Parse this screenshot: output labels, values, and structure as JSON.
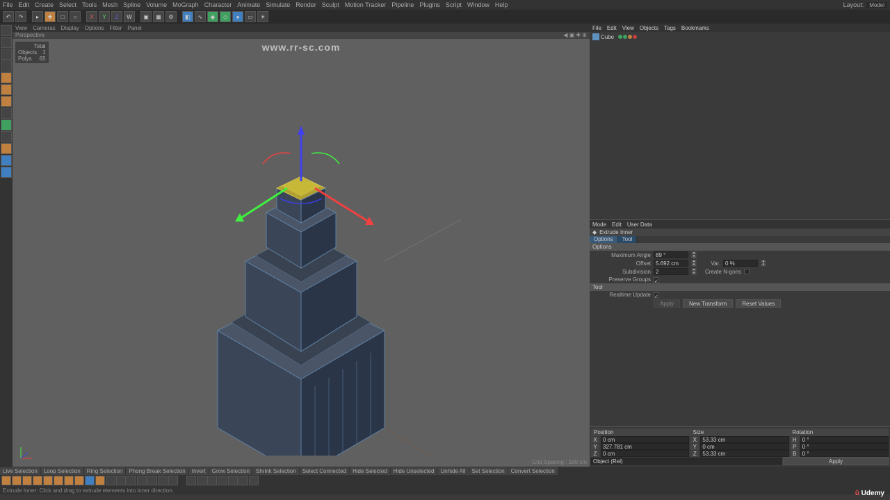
{
  "menubar": [
    "File",
    "Edit",
    "Create",
    "Select",
    "Tools",
    "Mesh",
    "Spline",
    "Volume",
    "MoGraph",
    "Character",
    "Animate",
    "Simulate",
    "Render",
    "Sculpt",
    "Motion Tracker",
    "Pipeline",
    "Plugins",
    "Script",
    "Window",
    "Help"
  ],
  "layout": {
    "label": "Layout:",
    "value": "Model"
  },
  "viewport": {
    "menu": [
      "View",
      "Cameras",
      "Display",
      "Options",
      "Filter",
      "Panel"
    ],
    "title": "Perspective",
    "stats": {
      "total_label": "Total",
      "objects_label": "Objects",
      "objects": "1",
      "polys_label": "Polys",
      "polys": "65"
    },
    "grid": "Grid Spacing : 100 cm"
  },
  "objmgr": {
    "menu": [
      "File",
      "Edit",
      "View",
      "Objects",
      "Tags",
      "Bookmarks"
    ],
    "item": "Cube"
  },
  "attr": {
    "menu": [
      "Mode",
      "Edit",
      "User Data"
    ],
    "tool_name": "Extrude Inner",
    "tabs": [
      "Options",
      "Tool"
    ],
    "section_options": "Options",
    "max_angle_label": "Maximum Angle",
    "max_angle": "89 °",
    "offset_label": "Offset",
    "offset": "5.692 cm",
    "var_label": "Var.",
    "var": "0 %",
    "subdiv_label": "Subdivision",
    "subdiv": "2",
    "ngons_label": "Create N-gons",
    "preserve_label": "Preserve Groups",
    "section_tool": "Tool",
    "realtime_label": "Realtime Update",
    "apply_btn": "Apply",
    "new_transform_btn": "New Transform",
    "reset_btn": "Reset Values"
  },
  "coords": {
    "headers": [
      "Position",
      "Size",
      "Rotation"
    ],
    "x_label": "X",
    "x_pos": "0 cm",
    "x_size": "53.33 cm",
    "x_rot_label": "H",
    "x_rot": "0 °",
    "y_label": "Y",
    "y_pos": "327.781 cm",
    "y_size": "0 cm",
    "y_rot_label": "P",
    "y_rot": "0 °",
    "z_label": "Z",
    "z_pos": "0 cm",
    "z_size": "53.33 cm",
    "z_rot_label": "B",
    "z_rot": "0 °",
    "obj_label": "Object (Rel)",
    "apply": "Apply"
  },
  "selbar": [
    "Live Selection",
    "Loop Selection",
    "Ring Selection",
    "Phong Break Selection",
    "Invert",
    "Grow Selection",
    "Shrink Selection",
    "Select Connected",
    "Hide Selected",
    "Hide Unselected",
    "Unhide All",
    "Set Selection",
    "Convert Selection"
  ],
  "status": "Extrude Inner: Click and drag to extrude elements into inner direction.",
  "watermark": "www.rr-sc.com",
  "brand": "Udemy"
}
